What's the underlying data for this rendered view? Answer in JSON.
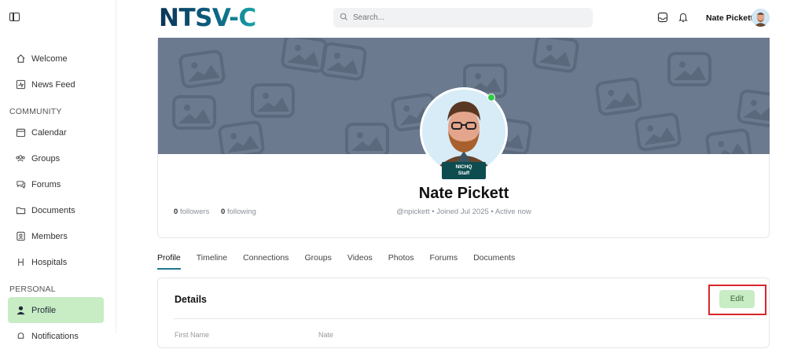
{
  "header": {
    "logo": "NTSV-C",
    "search_placeholder": "Search...",
    "user_name": "Nate Pickett"
  },
  "sidebar": {
    "items_top": [
      {
        "label": "Welcome",
        "icon": "home-icon"
      },
      {
        "label": "News Feed",
        "icon": "activity-icon"
      }
    ],
    "community_label": "COMMUNITY",
    "community_items": [
      {
        "label": "Calendar",
        "icon": "calendar-icon"
      },
      {
        "label": "Groups",
        "icon": "groups-icon"
      },
      {
        "label": "Forums",
        "icon": "chat-icon"
      },
      {
        "label": "Documents",
        "icon": "folder-icon"
      },
      {
        "label": "Members",
        "icon": "members-icon"
      },
      {
        "label": "Hospitals",
        "icon": "hospital-icon"
      }
    ],
    "personal_label": "PERSONAL",
    "personal_items": [
      {
        "label": "Profile",
        "icon": "user-icon",
        "active": true
      },
      {
        "label": "Notifications",
        "icon": "bell-icon"
      }
    ]
  },
  "profile": {
    "name": "Nate Pickett",
    "badge_line1": "NICHQ",
    "badge_line2": "Staff",
    "meta": "@npickett • Joined Jul 2025 • Active now",
    "followers_count": "0",
    "followers_label": "followers",
    "following_count": "0",
    "following_label": "following",
    "online": true
  },
  "tabs": [
    "Profile",
    "Timeline",
    "Connections",
    "Groups",
    "Videos",
    "Photos",
    "Forums",
    "Documents"
  ],
  "active_tab": "Profile",
  "details": {
    "title": "Details",
    "edit_label": "Edit",
    "first_row_label": "First Name",
    "first_row_value": "Nate"
  },
  "colors": {
    "accent_green": "#c8ecc4",
    "cover": "#6b7a8f",
    "badge": "#0e4d4f",
    "highlight": "#d7262b"
  }
}
